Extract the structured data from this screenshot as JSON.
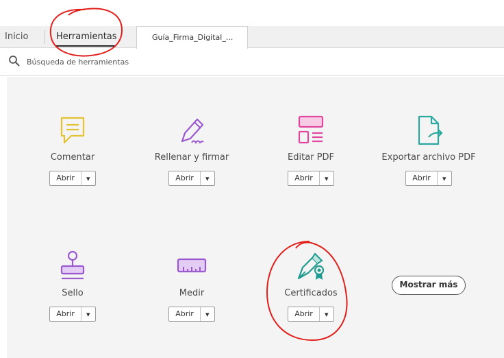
{
  "tabs": {
    "home": "Inicio",
    "tools": "Herramientas",
    "document": "Guía_Firma_Digital_..."
  },
  "search": {
    "placeholder": "Búsqueda de herramientas",
    "icon": "search-icon"
  },
  "tools": [
    {
      "id": "comentar",
      "label": "Comentar",
      "button": "Abrir",
      "icon": "comment-icon",
      "color": "#e5c233"
    },
    {
      "id": "rellenar",
      "label": "Rellenar y firmar",
      "button": "Abrir",
      "icon": "fill-sign-icon",
      "color": "#9b59d0"
    },
    {
      "id": "editar",
      "label": "Editar PDF",
      "button": "Abrir",
      "icon": "edit-pdf-icon",
      "color": "#e0479e"
    },
    {
      "id": "exportar",
      "label": "Exportar archivo PDF",
      "button": "Abrir",
      "icon": "export-pdf-icon",
      "color": "#2aa89e"
    },
    {
      "id": "sello",
      "label": "Sello",
      "button": "Abrir",
      "icon": "stamp-icon",
      "color": "#9b59d0"
    },
    {
      "id": "medir",
      "label": "Medir",
      "button": "Abrir",
      "icon": "measure-icon",
      "color": "#9b59d0"
    },
    {
      "id": "certificados",
      "label": "Certificados",
      "button": "Abrir",
      "icon": "certificates-icon",
      "color": "#1f9b8f"
    }
  ],
  "more_button": "Mostrar más",
  "annotation_color": "#e0201b"
}
